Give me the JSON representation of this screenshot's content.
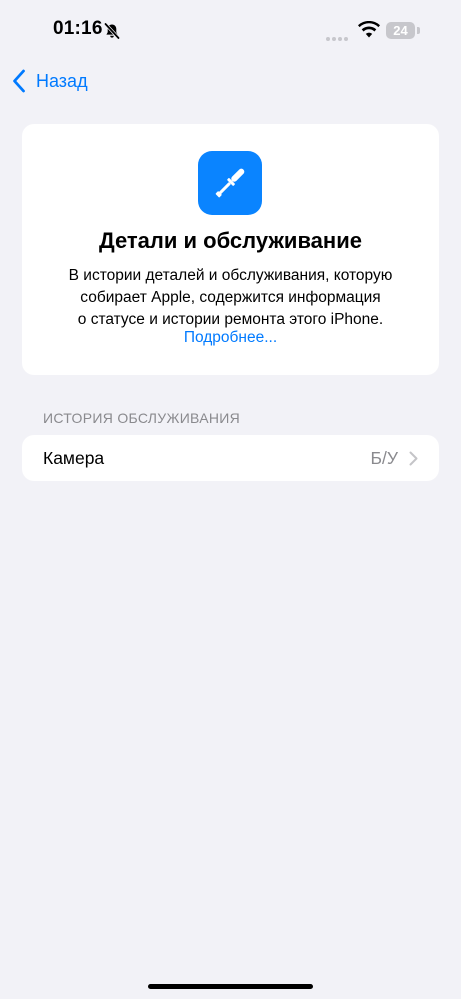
{
  "status_bar": {
    "time": "01:16",
    "battery": "24"
  },
  "nav": {
    "back_label": "Назад"
  },
  "info_card": {
    "title": "Детали и обслуживание",
    "description_lines": [
      "В истории деталей и обслуживания, которую",
      "собирает Apple, содержится информация",
      "о статусе и истории ремонта этого iPhone."
    ],
    "link": "Подробнее...",
    "icon": "screwdriver-icon",
    "accent": "#0a84ff"
  },
  "service_history": {
    "header": "ИСТОРИЯ ОБСЛУЖИВАНИЯ",
    "rows": [
      {
        "label": "Камера",
        "value": "Б/У"
      }
    ]
  }
}
